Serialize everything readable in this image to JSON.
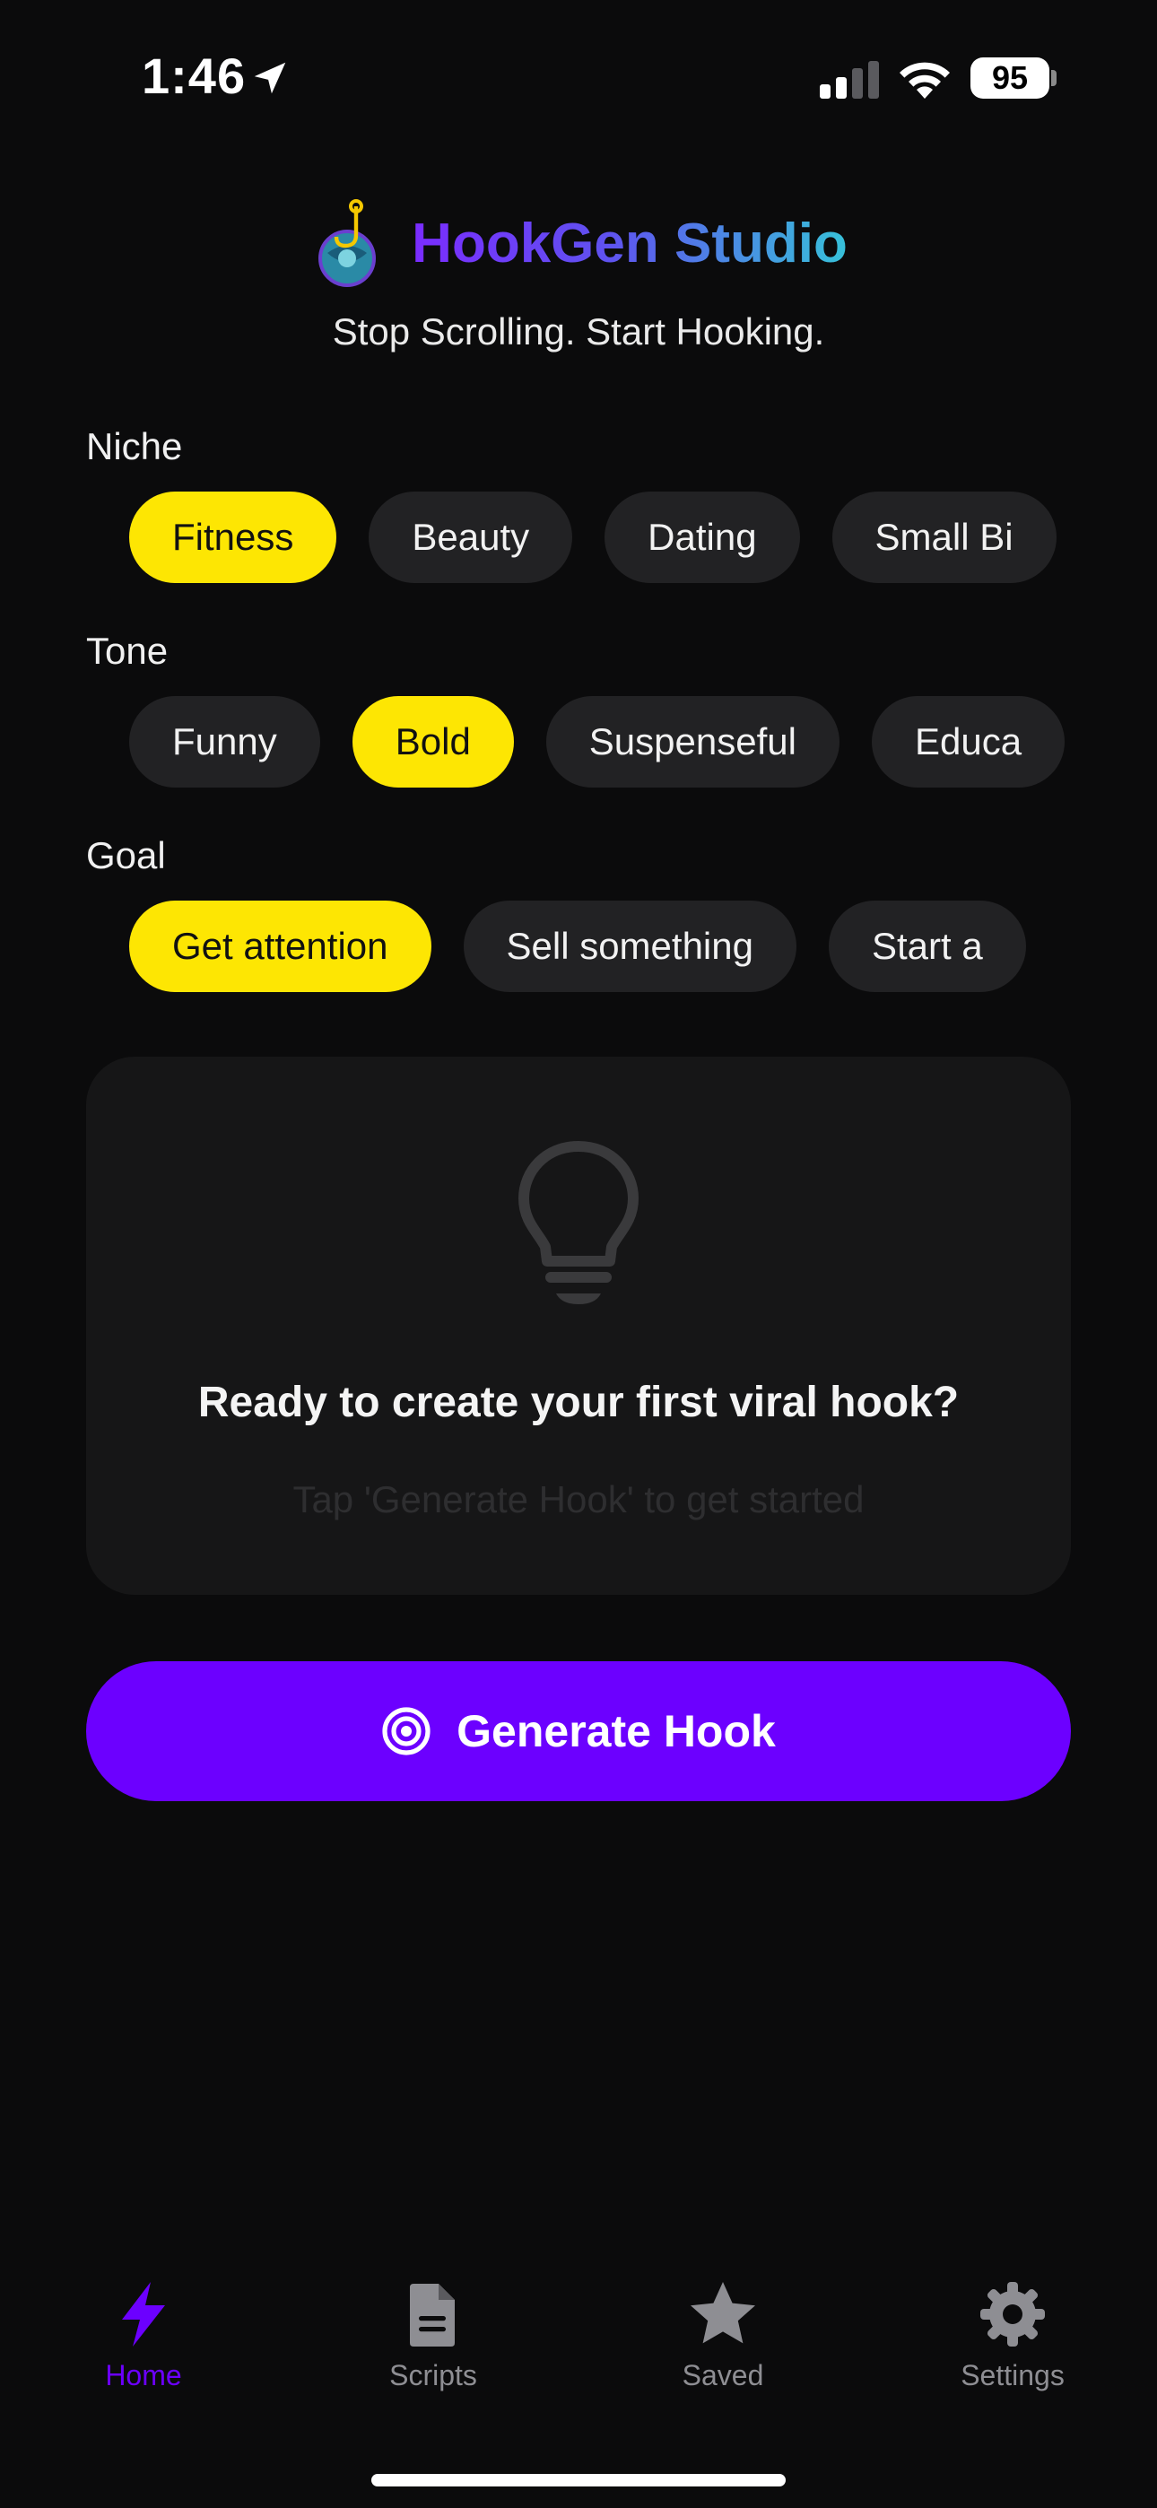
{
  "status_bar": {
    "time": "1:46",
    "battery": "95"
  },
  "header": {
    "title": "HookGen Studio",
    "tagline": "Stop Scrolling. Start Hooking."
  },
  "niche": {
    "label": "Niche",
    "options": [
      "Fitness",
      "Beauty",
      "Dating",
      "Small Bi"
    ],
    "selected": "Fitness"
  },
  "tone": {
    "label": "Tone",
    "options": [
      "Funny",
      "Bold",
      "Suspenseful",
      "Educa"
    ],
    "selected": "Bold"
  },
  "goal": {
    "label": "Goal",
    "options": [
      "Get attention",
      "Sell something",
      "Start a"
    ],
    "selected": "Get attention"
  },
  "empty_state": {
    "icon": "lightbulb-icon",
    "title": "Ready to create your first viral hook?",
    "subtitle": "Tap 'Generate Hook' to get started"
  },
  "generate_button": {
    "label": "Generate Hook",
    "icon": "target-icon"
  },
  "tabs": [
    {
      "label": "Home",
      "icon": "bolt-icon",
      "active": true
    },
    {
      "label": "Scripts",
      "icon": "document-icon",
      "active": false
    },
    {
      "label": "Saved",
      "icon": "star-icon",
      "active": false
    },
    {
      "label": "Settings",
      "icon": "gear-icon",
      "active": false
    }
  ],
  "colors": {
    "background": "#0b0b0c",
    "accent": "#6c00ff",
    "chip_selected": "#fde603",
    "chip": "#222224",
    "card": "#161617"
  }
}
